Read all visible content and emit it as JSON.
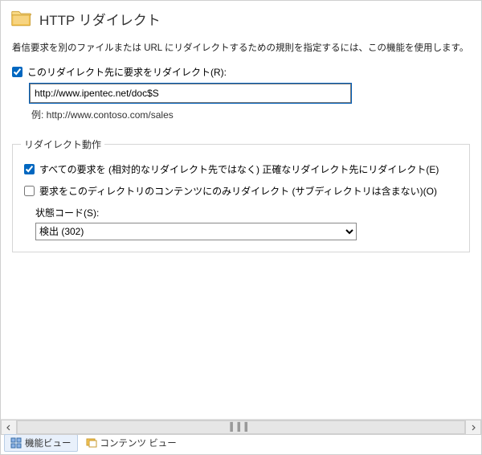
{
  "title": "HTTP リダイレクト",
  "description": "着信要求を別のファイルまたは URL にリダイレクトするための規則を指定するには、この機能を使用します。",
  "redirect_enable": {
    "label": "このリダイレクト先に要求をリダイレクト(R):",
    "checked": true
  },
  "redirect_url": {
    "value": "http://www.ipentec.net/doc$S"
  },
  "example_prefix": "例: ",
  "example_url": "http://www.contoso.com/sales",
  "behavior": {
    "legend": "リダイレクト動作",
    "exact": {
      "label": "すべての要求を (相対的なリダイレクト先ではなく) 正確なリダイレクト先にリダイレクト(E)",
      "checked": true
    },
    "only_dir": {
      "label": "要求をこのディレクトリのコンテンツにのみリダイレクト (サブディレクトリは含まない)(O)",
      "checked": false
    },
    "status_label": "状態コード(S):",
    "status_value": "検出 (302)"
  },
  "view_tabs": {
    "features": "機能ビュー",
    "content": "コンテンツ ビュー"
  }
}
